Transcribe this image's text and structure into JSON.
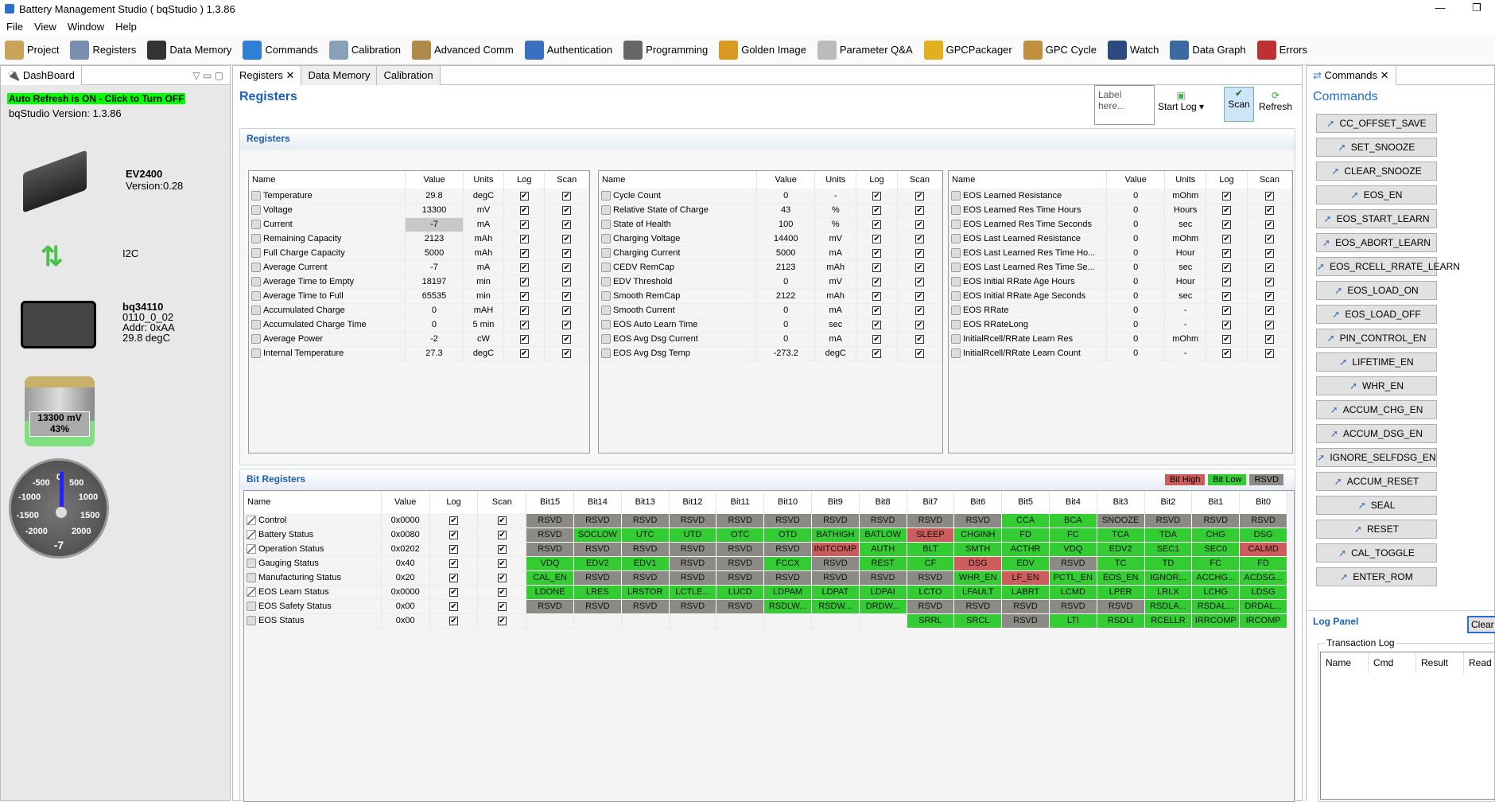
{
  "window": {
    "title": "Battery Management Studio ( bqStudio ) 1.3.86",
    "minimize": "—",
    "restore": "❐"
  },
  "menu": [
    "File",
    "View",
    "Window",
    "Help"
  ],
  "toolbar": [
    {
      "label": "Project",
      "color": "#c9a35a"
    },
    {
      "label": "Registers",
      "color": "#7a8fb0"
    },
    {
      "label": "Data Memory",
      "color": "#333"
    },
    {
      "label": "Commands",
      "color": "#2f7fd6"
    },
    {
      "label": "Calibration",
      "color": "#8aa0b8"
    },
    {
      "label": "Advanced Comm",
      "color": "#b08a4a"
    },
    {
      "label": "Authentication",
      "color": "#3a70c0"
    },
    {
      "label": "Programming",
      "color": "#666"
    },
    {
      "label": "Golden Image",
      "color": "#d89a20"
    },
    {
      "label": "Parameter Q&A",
      "color": "#bbb"
    },
    {
      "label": "GPCPackager",
      "color": "#e0b020"
    },
    {
      "label": "GPC Cycle",
      "color": "#c09040"
    },
    {
      "label": "Watch",
      "color": "#2a4a80"
    },
    {
      "label": "Data Graph",
      "color": "#3a6aa0"
    },
    {
      "label": "Errors",
      "color": "#c03030"
    }
  ],
  "dashboard": {
    "tab": "DashBoard",
    "auto_refresh": "Auto Refresh is ON - Click to Turn OFF",
    "version": "bqStudio Version:  1.3.86",
    "adapter": "EV2400",
    "adapter_version": "Version:0.28",
    "bus": "I2C",
    "device": "bq34110",
    "fw": "0110_0_02",
    "addr": "Addr: 0xAA",
    "temp": "29.8 degC",
    "battery_mv": "13300 mV",
    "battery_pct": "43%",
    "soc": 0.43,
    "gauge_value": "-7",
    "gauge_ticks": [
      "-2000",
      "-1500",
      "-1000",
      "-500",
      "0",
      "500",
      "1000",
      "1500",
      "2000"
    ]
  },
  "center": {
    "tabs": [
      "Registers",
      "Data Memory",
      "Calibration"
    ],
    "title": "Registers",
    "label_placeholder": "Label here...",
    "start_log": "Start Log",
    "scan": "Scan",
    "refresh": "Refresh",
    "registers_section": "Registers",
    "bit_section": "Bit Registers",
    "legend": {
      "high": "Bit High",
      "low": "Bit Low",
      "rsvd": "RSVD"
    }
  },
  "reg_headers": [
    "Name",
    "Value",
    "Units",
    "Log",
    "Scan"
  ],
  "reg_tables": [
    [
      [
        "Temperature",
        "29.8",
        "degC"
      ],
      [
        "Voltage",
        "13300",
        "mV"
      ],
      [
        "Current",
        "-7",
        "mA"
      ],
      [
        "Remaining Capacity",
        "2123",
        "mAh"
      ],
      [
        "Full Charge Capacity",
        "5000",
        "mAh"
      ],
      [
        "Average Current",
        "-7",
        "mA"
      ],
      [
        "Average Time to Empty",
        "18197",
        "min"
      ],
      [
        "Average Time to Full",
        "65535",
        "min"
      ],
      [
        "Accumulated Charge",
        "0",
        "mAH"
      ],
      [
        "Accumulated Charge Time",
        "0",
        "5 min"
      ],
      [
        "Average Power",
        "-2",
        "cW"
      ],
      [
        "Internal Temperature",
        "27.3",
        "degC"
      ]
    ],
    [
      [
        "Cycle Count",
        "0",
        "-"
      ],
      [
        "Relative State of Charge",
        "43",
        "%"
      ],
      [
        "State of Health",
        "100",
        "%"
      ],
      [
        "Charging Voltage",
        "14400",
        "mV"
      ],
      [
        "Charging Current",
        "5000",
        "mA"
      ],
      [
        "CEDV RemCap",
        "2123",
        "mAh"
      ],
      [
        "EDV Threshold",
        "0",
        "mV"
      ],
      [
        "Smooth RemCap",
        "2122",
        "mAh"
      ],
      [
        "Smooth Current",
        "0",
        "mA"
      ],
      [
        "EOS Auto Learn Time",
        "0",
        "sec"
      ],
      [
        "EOS Avg Dsg Current",
        "0",
        "mA"
      ],
      [
        "EOS Avg Dsg Temp",
        "-273.2",
        "degC"
      ]
    ],
    [
      [
        "EOS Learned Resistance",
        "0",
        "mOhm"
      ],
      [
        "EOS Learned Res Time Hours",
        "0",
        "Hours"
      ],
      [
        "EOS Learned Res Time Seconds",
        "0",
        "sec"
      ],
      [
        "EOS Last Learned Resistance",
        "0",
        "mOhm"
      ],
      [
        "EOS Last Learned Res Time Ho...",
        "0",
        "Hour"
      ],
      [
        "EOS Last Learned Res Time Se...",
        "0",
        "sec"
      ],
      [
        "EOS Initial RRate Age Hours",
        "0",
        "Hour"
      ],
      [
        "EOS Initial RRate Age Seconds",
        "0",
        "sec"
      ],
      [
        "EOS RRate",
        "0",
        "-"
      ],
      [
        "EOS RRateLong",
        "0",
        "-"
      ],
      [
        "InitialRcell/RRate Learn Res",
        "0",
        "mOhm"
      ],
      [
        "InitialRcell/RRate Learn Count",
        "0",
        "-"
      ]
    ]
  ],
  "bit_headers": [
    "Name",
    "Value",
    "Log",
    "Scan",
    "Bit15",
    "Bit14",
    "Bit13",
    "Bit12",
    "Bit11",
    "Bit10",
    "Bit9",
    "Bit8",
    "Bit7",
    "Bit6",
    "Bit5",
    "Bit4",
    "Bit3",
    "Bit2",
    "Bit1",
    "Bit0"
  ],
  "colors": {
    "high": "#cd5c5c",
    "low": "#33cc33",
    "rsvd": "#8c8a85"
  },
  "bit_rows": [
    {
      "name": "Control",
      "value": "0x0000",
      "icon": "pen",
      "bits": [
        "RSVD",
        "RSVD",
        "RSVD",
        "RSVD",
        "RSVD",
        "RSVD",
        "RSVD",
        "RSVD",
        "RSVD",
        "RSVD",
        "CCA",
        "BCA",
        "SNOOZE",
        "RSVD",
        "RSVD",
        "RSVD"
      ],
      "state": "rrrrrrrrrrllrrrr"
    },
    {
      "name": "Battery Status",
      "value": "0x0080",
      "icon": "pen",
      "bits": [
        "RSVD",
        "SOCLOW",
        "UTC",
        "UTD",
        "OTC",
        "OTD",
        "BATHIGH",
        "BATLOW",
        "SLEEP",
        "CHGINH",
        "FD",
        "FC",
        "TCA",
        "TDA",
        "CHG",
        "DSG"
      ],
      "state": "rlllllllhlllllll"
    },
    {
      "name": "Operation Status",
      "value": "0x0202",
      "icon": "pen",
      "bits": [
        "RSVD",
        "RSVD",
        "RSVD",
        "RSVD",
        "RSVD",
        "RSVD",
        "INITCOMP",
        "AUTH",
        "BLT",
        "SMTH",
        "ACTHR",
        "VDQ",
        "EDV2",
        "SEC1",
        "SEC0",
        "CALMD"
      ],
      "state": "rrrrrrhllllllllhl"
    },
    {
      "name": "Gauging Status",
      "value": "0x40",
      "icon": "lock",
      "bits": [
        "VDQ",
        "EDV2",
        "EDV1",
        "RSVD",
        "RSVD",
        "FCCX",
        "RSVD",
        "REST",
        "CF",
        "DSG",
        "EDV",
        "RSVD",
        "TC",
        "TD",
        "FC",
        "FD"
      ],
      "state": "lllrrlrllhlrllll"
    },
    {
      "name": "Manufacturing Status",
      "value": "0x20",
      "icon": "lock",
      "bits": [
        "CAL_EN",
        "RSVD",
        "RSVD",
        "RSVD",
        "RSVD",
        "RSVD",
        "RSVD",
        "RSVD",
        "RSVD",
        "WHR_EN",
        "LF_EN",
        "PCTL_EN",
        "EOS_EN",
        "IGNOR...",
        "ACCHG...",
        "ACDSG..."
      ],
      "state": "lrrrrrrrrlhlllll"
    },
    {
      "name": "EOS Learn Status",
      "value": "0x0000",
      "icon": "pen",
      "bits": [
        "LDONE",
        "LRES",
        "LRSTOR",
        "LCTLE...",
        "LUCD",
        "LDPAM",
        "LDPAT",
        "LDPAI",
        "LCTO",
        "LFAULT",
        "LABRT",
        "LCMD",
        "LPER",
        "LRLX",
        "LCHG",
        "LDSG"
      ],
      "state": "llllllllllllllll"
    },
    {
      "name": "EOS Safety Status",
      "value": "0x00",
      "icon": "lock",
      "bits": [
        "RSVD",
        "RSVD",
        "RSVD",
        "RSVD",
        "RSVD",
        "RSDLW...",
        "RSDW...",
        "DRDW...",
        "RSVD",
        "RSVD",
        "RSVD",
        "RSVD",
        "RSVD",
        "RSDLA...",
        "RSDAL...",
        "DRDAL..."
      ],
      "state": "rrrrrlllrrrrrlll"
    },
    {
      "name": "EOS Status",
      "value": "0x00",
      "icon": "lock",
      "bits": [
        "",
        "",
        "",
        "",
        "",
        "",
        "",
        "",
        "SRRL",
        "SRCL",
        "RSVD",
        "LTI",
        "RSDLI",
        "RCELLR",
        "IRRCOMP",
        "IRCOMP"
      ],
      "state": "eeeeeeeellrlllll"
    }
  ],
  "commands": {
    "tab": "Commands",
    "title": "Commands",
    "items": [
      "CC_OFFSET_SAVE",
      "SET_SNOOZE",
      "CLEAR_SNOOZE",
      "EOS_EN",
      "EOS_START_LEARN",
      "EOS_ABORT_LEARN",
      "EOS_RCELL_RRATE_LEARN",
      "EOS_LOAD_ON",
      "EOS_LOAD_OFF",
      "PIN_CONTROL_EN",
      "LIFETIME_EN",
      "WHR_EN",
      "ACCUM_CHG_EN",
      "ACCUM_DSG_EN",
      "IGNORE_SELFDSG_EN",
      "ACCUM_RESET",
      "SEAL",
      "RESET",
      "CAL_TOGGLE",
      "ENTER_ROM"
    ]
  },
  "log": {
    "title": "Log Panel",
    "clear": "Clear",
    "group": "Transaction Log",
    "columns": [
      "Name",
      "Cmd",
      "Result",
      "Read"
    ]
  }
}
